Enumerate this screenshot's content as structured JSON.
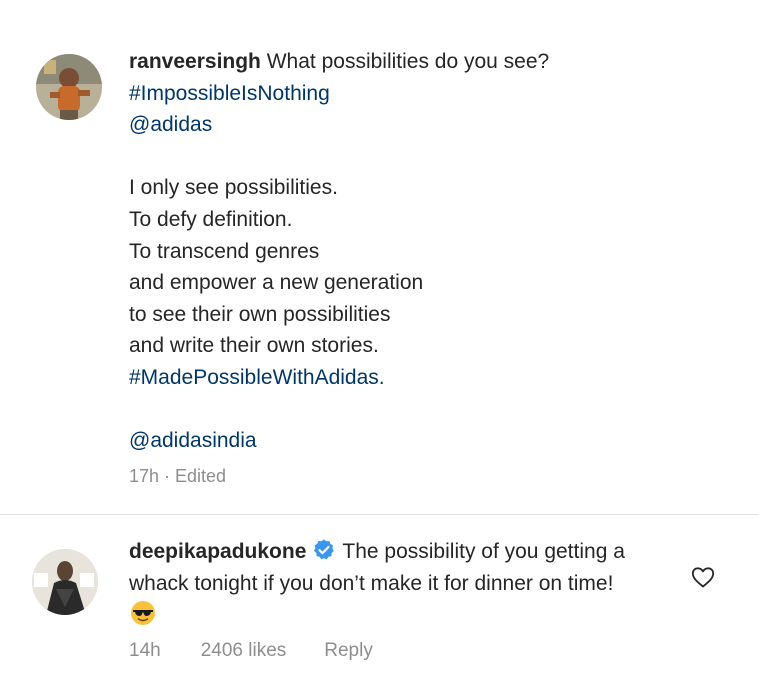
{
  "caption": {
    "username": "ranveersingh",
    "lines": [
      "What possibilities do you see?",
      "#ImpossibleIsNothing",
      "@adidas",
      "",
      "I only see possibilities.",
      "To defy definition.",
      "To transcend genres",
      "and empower a new generation",
      "to see their own possibilities",
      "and write their own stories.",
      "#MadePossibleWithAdidas.",
      "",
      "@adidasindia"
    ],
    "meta": "17h · Edited"
  },
  "comment": {
    "username": "deepikapadukone",
    "text_line1": "The possibility of you getting a",
    "text_line2": "whack tonight if you don’t make it for dinner on time!",
    "emoji_icon": "sunglasses-emoji-icon",
    "time": "14h",
    "likes": "2406 likes",
    "reply_label": "Reply"
  },
  "colors": {
    "hashtag": "#00376b",
    "secondary_text": "#8e8e8e",
    "verified": "#3897f0"
  }
}
